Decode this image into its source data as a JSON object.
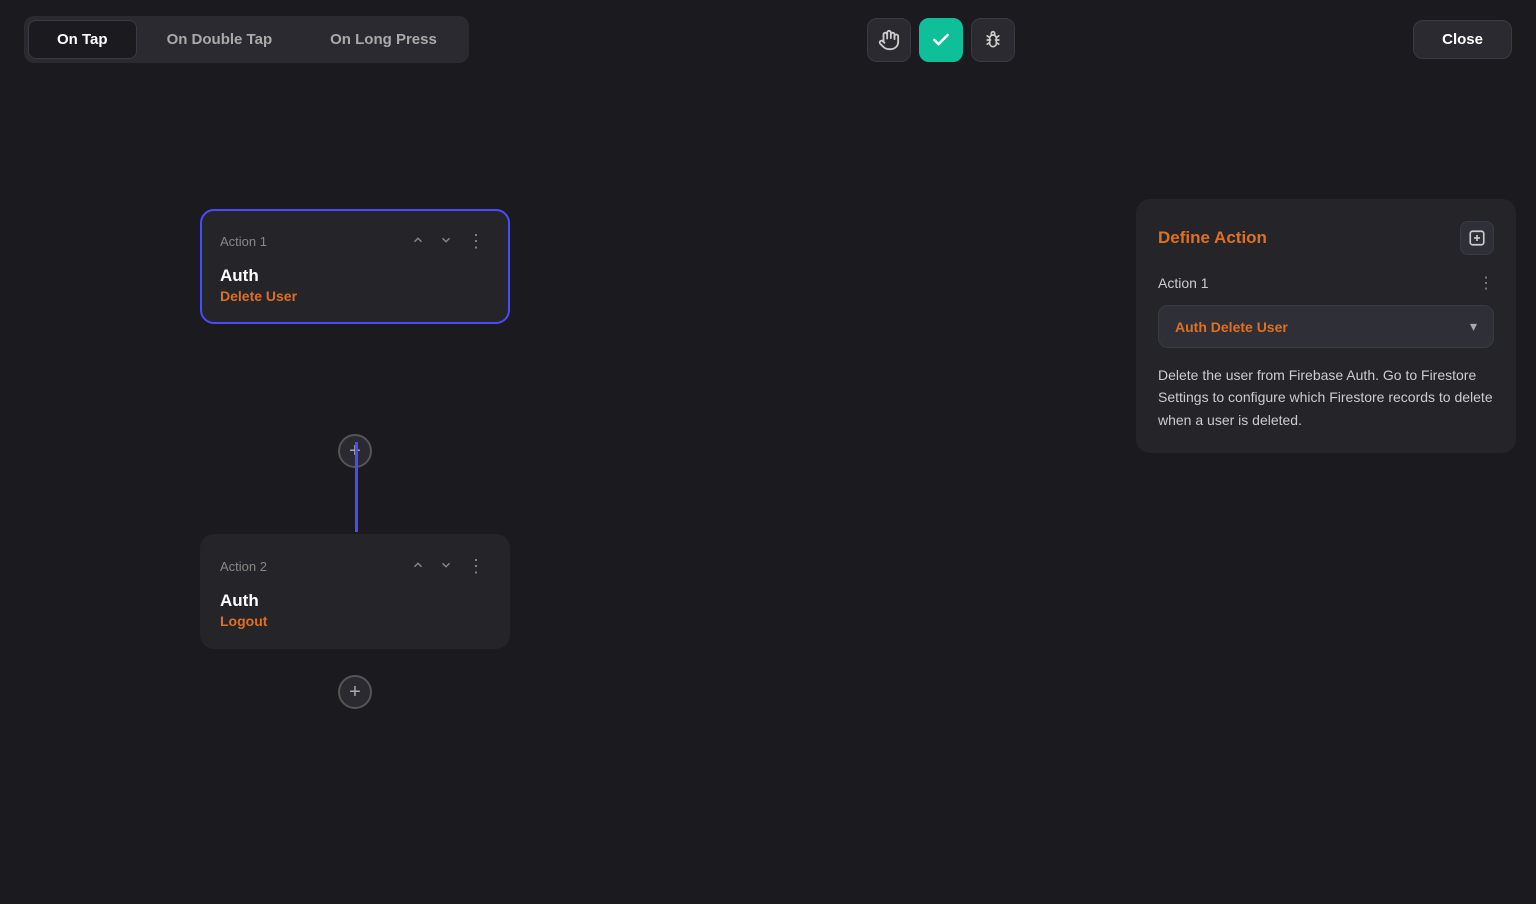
{
  "header": {
    "tabs": [
      {
        "id": "on-tap",
        "label": "On Tap",
        "active": true
      },
      {
        "id": "on-double-tap",
        "label": "On Double Tap",
        "active": false
      },
      {
        "id": "on-long-press",
        "label": "On Long Press",
        "active": false
      }
    ],
    "center_buttons": [
      {
        "id": "gesture-icon",
        "icon": "🖐",
        "active": false
      },
      {
        "id": "check-icon",
        "icon": "✓",
        "active": true
      },
      {
        "id": "bug-icon",
        "icon": "🐛",
        "active": false
      }
    ],
    "close_button_label": "Close"
  },
  "canvas": {
    "action1": {
      "label": "Action 1",
      "title": "Auth",
      "subtitle": "Delete User",
      "selected": true
    },
    "action2": {
      "label": "Action 2",
      "title": "Auth",
      "subtitle": "Logout",
      "selected": false
    }
  },
  "right_panel": {
    "title": "Define Action",
    "action_label": "Action 1",
    "select_label": "Auth",
    "select_value": "Delete User",
    "description": "Delete the user from Firebase Auth. Go to Firestore Settings to configure which Firestore records to delete when a user is deleted."
  }
}
